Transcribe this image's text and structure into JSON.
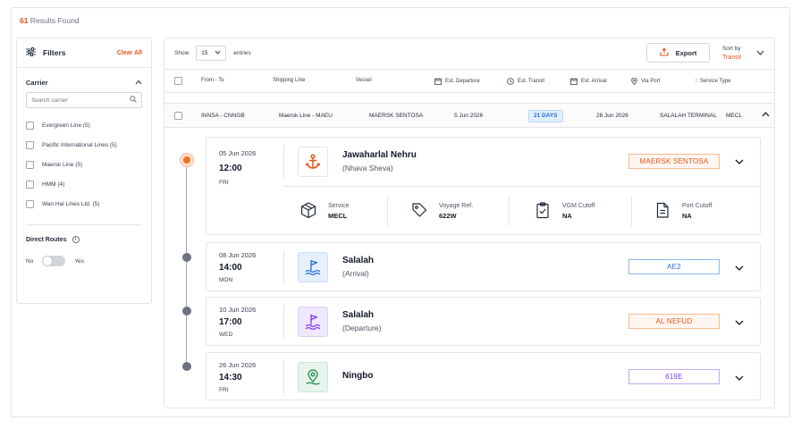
{
  "results": {
    "count": "61",
    "label": "Results Found"
  },
  "filters": {
    "title": "Filters",
    "clear_all": "Clear All",
    "carrier_label": "Carrier",
    "search_placeholder": "Search carrier",
    "carriers": [
      "Evergreen Line (5)",
      "Pacific International Lines (5)",
      "Maersk Line (5)",
      "HMM (4)",
      "Wan Hai Lines Ltd. (5)"
    ],
    "direct_routes": "Direct Routes",
    "toggle_no": "No",
    "toggle_yes": "Yes"
  },
  "toolbar": {
    "show": "Show",
    "entries_value": "15",
    "entries": "entries",
    "export": "Export",
    "sort_by": "Sort by",
    "sort_value": "Transit"
  },
  "columns": {
    "from_to": "From - To",
    "shipping_line": "Shipping Line",
    "vessel": "Vessel",
    "est_departure": "Est. Departure",
    "est_transit": "Est. Transit",
    "est_arrival": "Est. Arrival",
    "via_port": "Via Port",
    "service_type": "Service Type"
  },
  "row": {
    "from_to": "INNSA - CNNGB",
    "shipping_line": "Maersk Line - MAEU",
    "vessel": "MAERSK SENTOSA",
    "departure": "5 Jun 2026",
    "transit": "21 DAYS",
    "arrival": "26 Jun 2026",
    "via_port": "SALALAH TERMINAL",
    "service": "MECL"
  },
  "stops": [
    {
      "date": "05 Jun 2026",
      "time": "12:00",
      "day": "FRI",
      "port": "Jawaharlal Nehru",
      "sub": "(Nhava Sheva)",
      "tag": "MAERSK SENTOSA",
      "tag_color": "#e8541c",
      "icon": "anchor-icon"
    },
    {
      "date": "08 Jun 2026",
      "time": "14:00",
      "day": "MON",
      "port": "Salalah",
      "sub": "(Arrival)",
      "tag": "AE2",
      "tag_color": "#1d6fd6",
      "icon": "arrival-flag-icon"
    },
    {
      "date": "10 Jun 2026",
      "time": "17:00",
      "day": "WED",
      "port": "Salalah",
      "sub": "(Departure)",
      "tag": "AL NEFUD",
      "tag_color": "#e8541c",
      "icon": "departure-flag-icon"
    },
    {
      "date": "26 Jun 2026",
      "time": "14:30",
      "day": "FRI",
      "port": "Ningbo",
      "sub": "",
      "tag": "619E",
      "tag_color": "#7c3aed",
      "icon": "location-pin-icon"
    }
  ],
  "details": {
    "service_label": "Service",
    "service_value": "MECL",
    "voyage_label": "Voyage Ref.",
    "voyage_value": "622W",
    "vgm_label": "VGM Cutoff",
    "vgm_value": "NA",
    "port_cutoff_label": "Port Cutoff",
    "port_cutoff_value": "NA"
  }
}
